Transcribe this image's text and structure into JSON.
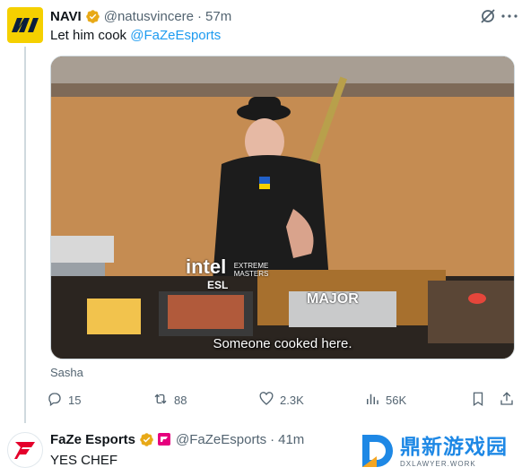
{
  "tweet": {
    "author_name": "NAVI",
    "handle": "@natusvincere",
    "separator": "·",
    "time": "57m",
    "text_prefix": "Let him cook ",
    "mention": "@FaZeEsports",
    "media": {
      "caption": "Someone cooked here.",
      "overlay_logo": "intel",
      "overlay_logo_sub": "EXTREME MASTERS",
      "overlay_esl": "ESL",
      "overlay_major": "MAJOR"
    },
    "credit": "Sasha",
    "actions": {
      "replies": "15",
      "reposts": "88",
      "likes": "2.3K",
      "views": "56K"
    }
  },
  "reply": {
    "author_name": "FaZe Esports",
    "handle": "@FaZeEsports",
    "separator": "·",
    "time": "41m",
    "text": "YES CHEF"
  },
  "watermark": {
    "text_cn": "鼎新游戏园",
    "text_en": "DXLAWYER.WORK"
  },
  "colors": {
    "accent": "#1d9bf0",
    "verified_gold": "#e8a917",
    "muted": "#536471"
  },
  "icons": [
    "grok-icon",
    "more-icon",
    "verified-icon",
    "reply-icon",
    "repost-icon",
    "like-icon",
    "views-icon",
    "bookmark-icon",
    "share-icon",
    "affiliate-badge-icon"
  ]
}
